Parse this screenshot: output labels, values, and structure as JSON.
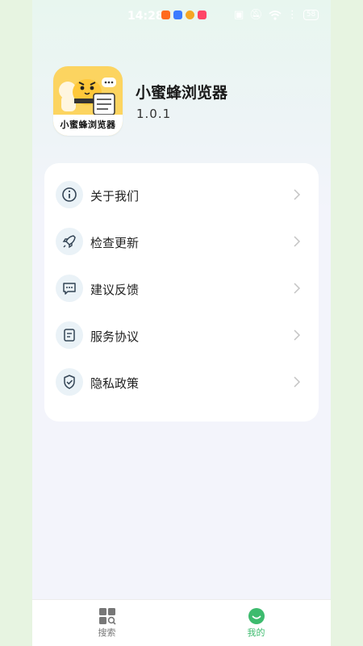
{
  "status_bar": {
    "time": "14:28",
    "battery": "58"
  },
  "app": {
    "name": "小蜜蜂浏览器",
    "icon_caption": "小蜜蜂浏览器",
    "version": "1.0.1"
  },
  "menu": {
    "items": [
      {
        "label": "关于我们",
        "icon": "info-icon"
      },
      {
        "label": "检查更新",
        "icon": "rocket-icon"
      },
      {
        "label": "建议反馈",
        "icon": "chat-bubble-icon"
      },
      {
        "label": "服务协议",
        "icon": "document-icon"
      },
      {
        "label": "隐私政策",
        "icon": "shield-check-icon"
      }
    ]
  },
  "tabbar": {
    "tabs": [
      {
        "label": "搜索",
        "icon": "grid-search-icon",
        "active": false
      },
      {
        "label": "我的",
        "icon": "smiley-icon",
        "active": true
      }
    ]
  },
  "colors": {
    "accent": "#3dbb6e",
    "inactive_tab": "#777777",
    "icon_bg": "#eaf2f7",
    "icon_stroke": "#334455",
    "brand_yellow": "#fcd460"
  }
}
